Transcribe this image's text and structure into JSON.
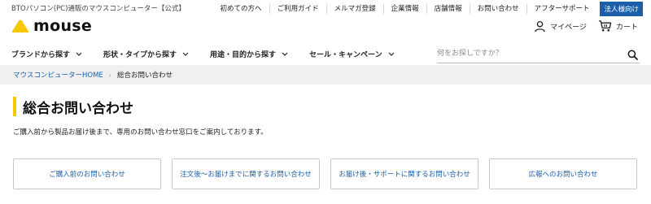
{
  "header": {
    "tagline": "BTOパソコン(PC)通販のマウスコンピューター【公式】",
    "utility_links": [
      "初めての方へ",
      "ご利用ガイド",
      "メルマガ登録",
      "企業情報",
      "店舗情報",
      "お問い合わせ",
      "アフターサポート"
    ],
    "corporate_button": "法人様向け",
    "logo_text": "mouse",
    "user_links": {
      "mypage_label": "マイページ",
      "cart_label": "カート"
    }
  },
  "main_nav": {
    "items": [
      "ブランドから探す",
      "形状・タイプから探す",
      "用途・目的から探す",
      "セール・キャンペーン"
    ]
  },
  "search": {
    "placeholder": "何をお探しですか？"
  },
  "breadcrumb": {
    "home": "マウスコンピューターHOME",
    "separator": "›",
    "current": "総合お問い合わせ"
  },
  "page": {
    "title": "総合お問い合わせ",
    "intro": "ご購入前から製品お届け後まで、専用のお問い合わせ窓口をご案内しております。",
    "cards": [
      "ご購入前のお問い合わせ",
      "注文後〜お届けまでに関するお問い合わせ",
      "お届け後・サポートに関するお問い合わせ",
      "広報へのお問い合わせ"
    ]
  },
  "colors": {
    "link_blue": "#1c5fa8",
    "accent_yellow": "#f5c800",
    "breadcrumb_bg": "#f0f0f0"
  },
  "icons": {
    "logo_mark": "yellow-triangle-logo",
    "mypage": "user-icon",
    "cart": "cart-icon",
    "search": "search-icon",
    "nav_chevron": "chevron-down-icon"
  }
}
